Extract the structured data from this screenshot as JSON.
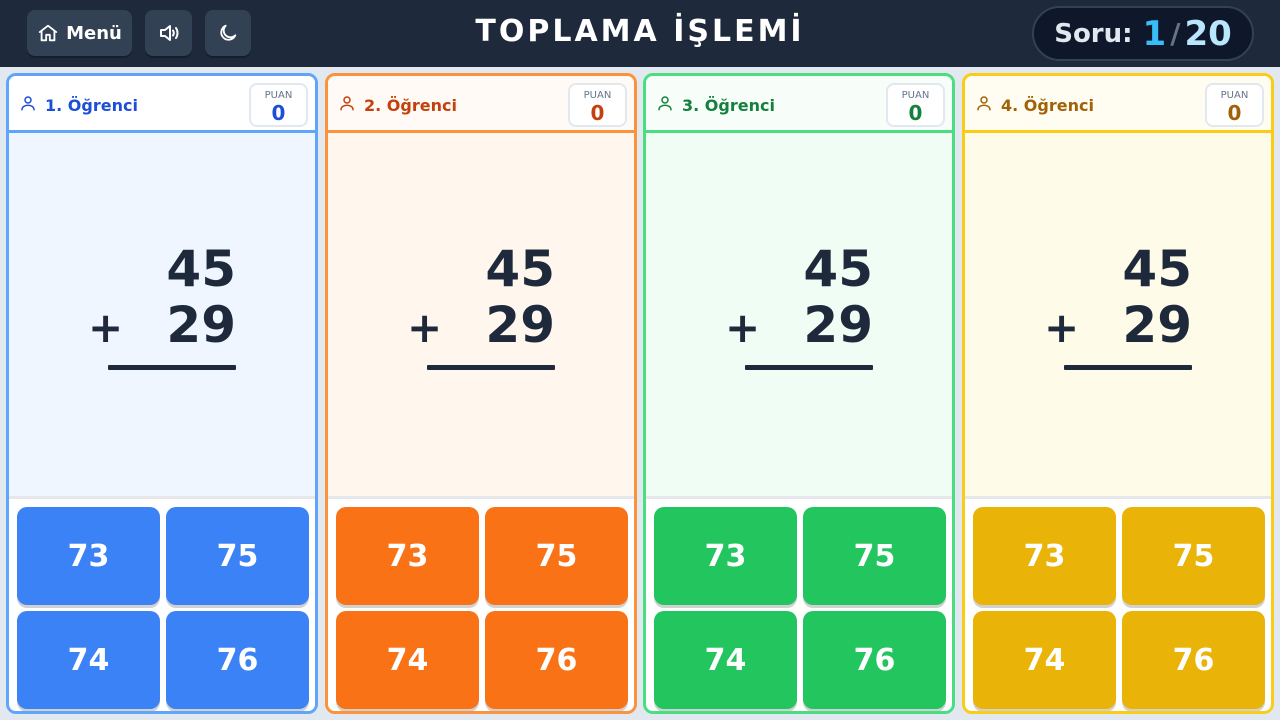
{
  "header": {
    "menu_label": "Menü",
    "title": "TOPLAMA İŞLEMİ",
    "counter_label": "Soru:",
    "current_question": "1",
    "separator": "/",
    "total_questions": "20"
  },
  "score_label": "PUAN",
  "problem": {
    "first": "45",
    "second": "29",
    "operator": "+"
  },
  "students": [
    {
      "name": "1. Öğrenci",
      "score": "0",
      "answers": [
        "73",
        "75",
        "74",
        "76"
      ],
      "colors": {
        "border": "#60a5fa",
        "header_bg": "#ffffff",
        "text": "#1d4ed8",
        "body_bg": "#eff6ff",
        "button": "#3b82f6"
      }
    },
    {
      "name": "2. Öğrenci",
      "score": "0",
      "answers": [
        "73",
        "75",
        "74",
        "76"
      ],
      "colors": {
        "border": "#fb923c",
        "header_bg": "#fffaf5",
        "text": "#c2410c",
        "body_bg": "#fff7ed",
        "button": "#f97316"
      }
    },
    {
      "name": "3. Öğrenci",
      "score": "0",
      "answers": [
        "73",
        "75",
        "74",
        "76"
      ],
      "colors": {
        "border": "#4ade80",
        "header_bg": "#f7fdf9",
        "text": "#15803d",
        "body_bg": "#f0fdf4",
        "button": "#22c55e"
      }
    },
    {
      "name": "4. Öğrenci",
      "score": "0",
      "answers": [
        "73",
        "75",
        "74",
        "76"
      ],
      "colors": {
        "border": "#facc15",
        "header_bg": "#fffdf2",
        "text": "#a16207",
        "body_bg": "#fefce8",
        "button": "#eab308"
      }
    }
  ],
  "icons": {
    "menu": "home-icon",
    "sound": "speaker-icon",
    "theme": "moon-icon",
    "student": "user-icon"
  }
}
